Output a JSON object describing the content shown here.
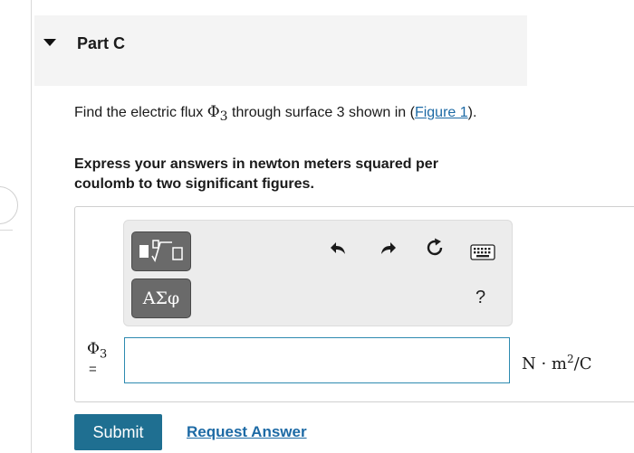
{
  "part": {
    "title": "Part C"
  },
  "question": {
    "prefix": "Find the electric flux ",
    "symbol": "Φ",
    "subscript": "3",
    "middle": " through surface 3 shown in (",
    "link_text": "Figure 1",
    "suffix": ")."
  },
  "instructions": "Express your answers in newton meters squared per coulomb to two significant figures.",
  "toolbar": {
    "templates_icon": "math-templates-icon",
    "greek_label": "ΑΣφ",
    "undo_icon": "undo-icon",
    "redo_icon": "redo-icon",
    "reset_icon": "reset-icon",
    "keyboard_icon": "keyboard-icon",
    "help_label": "?"
  },
  "answer": {
    "variable_symbol": "Φ",
    "variable_subscript": "3",
    "equals": "=",
    "value": "",
    "units": {
      "n": "N",
      "dot": " · ",
      "m": "m",
      "exp": "2",
      "rest": "/C"
    }
  },
  "actions": {
    "submit_label": "Submit",
    "request_label": "Request Answer"
  },
  "colors": {
    "accent": "#1f6f91",
    "link": "#1d6aa5",
    "input_border": "#2e8ab0",
    "header_bg": "#f4f4f4",
    "toolbar_bg": "#ececec",
    "template_button": "#6a6a6a"
  }
}
